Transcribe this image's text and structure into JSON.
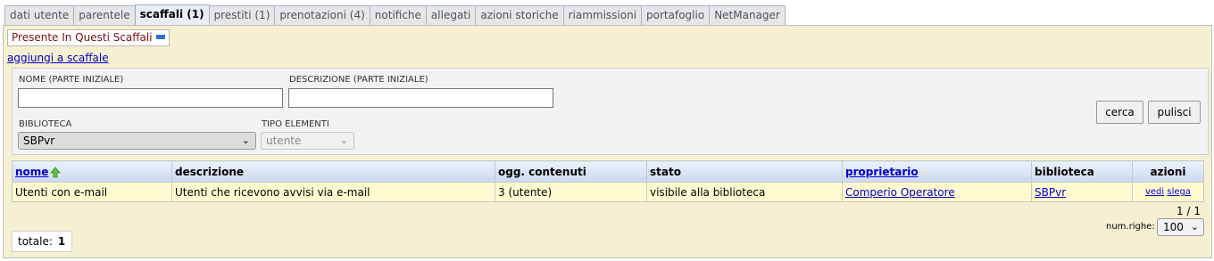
{
  "tabs": [
    {
      "label": "dati utente",
      "active": false
    },
    {
      "label": "parentele",
      "active": false
    },
    {
      "label": "scaffali (1)",
      "active": true
    },
    {
      "label": "prestiti (1)",
      "active": false
    },
    {
      "label": "prenotazioni (4)",
      "active": false
    },
    {
      "label": "notifiche",
      "active": false
    },
    {
      "label": "allegati",
      "active": false
    },
    {
      "label": "azioni storiche",
      "active": false
    },
    {
      "label": "riammissioni",
      "active": false
    },
    {
      "label": "portafoglio",
      "active": false
    },
    {
      "label": "NetManager",
      "active": false
    }
  ],
  "section": {
    "legend": "Presente In Questi Scaffali",
    "add_link": "aggiungi a scaffale"
  },
  "search": {
    "name_label": "NOME (PARTE INIZIALE)",
    "name_value": "",
    "desc_label": "DESCRIZIONE (PARTE INIZIALE)",
    "desc_value": "",
    "library_label": "BIBLIOTECA",
    "library_value": "SBPvr",
    "type_label": "TIPO ELEMENTI",
    "type_value": "utente",
    "search_btn": "cerca",
    "clear_btn": "pulisci"
  },
  "table": {
    "headers": {
      "nome": "nome",
      "descrizione": "descrizione",
      "contenuti": "ogg. contenuti",
      "stato": "stato",
      "proprietario": "proprietario",
      "biblioteca": "biblioteca",
      "azioni": "azioni"
    },
    "rows": [
      {
        "nome": "Utenti con e-mail",
        "descrizione": "Utenti che ricevono avvisi via e-mail",
        "contenuti": "3 (utente)",
        "stato": "visibile alla biblioteca",
        "proprietario": "Comperio Operatore",
        "biblioteca": "SBPvr",
        "azione_vedi": "vedi",
        "azione_slega": "slega"
      }
    ]
  },
  "pager": {
    "text": "1 / 1"
  },
  "rows_per_page": {
    "label": "num.righe:",
    "value": "100"
  },
  "total": {
    "label": "totale:",
    "value": "1"
  },
  "colors": {
    "panel_bg": "#f5f0d2",
    "row_bg": "#fffbd0",
    "link": "#0000cc",
    "legend_text": "#7a1010"
  },
  "icons": {
    "sort": "arrow-up-icon",
    "legend_toggle": "minus-icon",
    "select": "chevron-down-icon"
  }
}
